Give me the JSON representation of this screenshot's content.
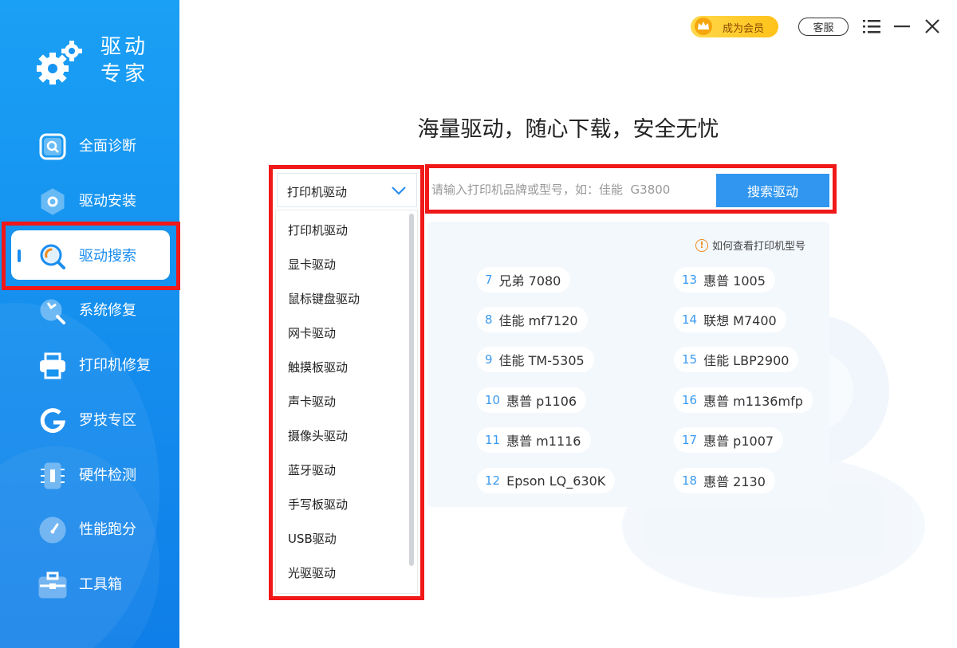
{
  "app": {
    "title_line1": "驱动",
    "title_line2": "专家"
  },
  "sidebar": {
    "items": [
      {
        "label": "全面诊断",
        "icon": "search-icon"
      },
      {
        "label": "驱动安装",
        "icon": "hexagon-icon"
      },
      {
        "label": "驱动搜索",
        "icon": "search-icon",
        "active": true
      },
      {
        "label": "系统修复",
        "icon": "wrench-icon"
      },
      {
        "label": "打印机修复",
        "icon": "printer-icon"
      },
      {
        "label": "罗技专区",
        "icon": "logitech-icon"
      },
      {
        "label": "硬件检测",
        "icon": "chip-icon"
      },
      {
        "label": "性能跑分",
        "icon": "speedometer-icon"
      },
      {
        "label": "工具箱",
        "icon": "toolbox-icon"
      }
    ]
  },
  "topbar": {
    "vip_label": "成为会员",
    "service_label": "客服"
  },
  "main": {
    "headline": "海量驱动，随心下载，安全无忧",
    "dropdown": {
      "selected": "打印机驱动",
      "options": [
        "打印机驱动",
        "显卡驱动",
        "鼠标键盘驱动",
        "网卡驱动",
        "触摸板驱动",
        "声卡驱动",
        "摄像头驱动",
        "蓝牙驱动",
        "手写板驱动",
        "USB驱动",
        "光驱驱动"
      ]
    },
    "search": {
      "placeholder": "请输入打印机品牌或型号，如：佳能  G3800",
      "button_label": "搜索驱动"
    },
    "howto_label": "如何查看打印机型号",
    "popular": [
      {
        "num": "7",
        "name": "兄弟 7080"
      },
      {
        "num": "13",
        "name": "惠普 1005"
      },
      {
        "num": "8",
        "name": "佳能 mf7120"
      },
      {
        "num": "14",
        "name": "联想 M7400"
      },
      {
        "num": "9",
        "name": "佳能 TM-5305"
      },
      {
        "num": "15",
        "name": "佳能 LBP2900"
      },
      {
        "num": "10",
        "name": "惠普 p1106"
      },
      {
        "num": "16",
        "name": "惠普 m1136mfp"
      },
      {
        "num": "11",
        "name": "惠普 m1116"
      },
      {
        "num": "17",
        "name": "惠普 p1007"
      },
      {
        "num": "12",
        "name": "Epson LQ_630K"
      },
      {
        "num": "18",
        "name": "惠普 2130"
      }
    ]
  },
  "colors": {
    "sidebar_top": "#1aa0f5",
    "sidebar_bottom": "#0f7ee8",
    "accent": "#3196ef",
    "highlight": "#f01818"
  }
}
